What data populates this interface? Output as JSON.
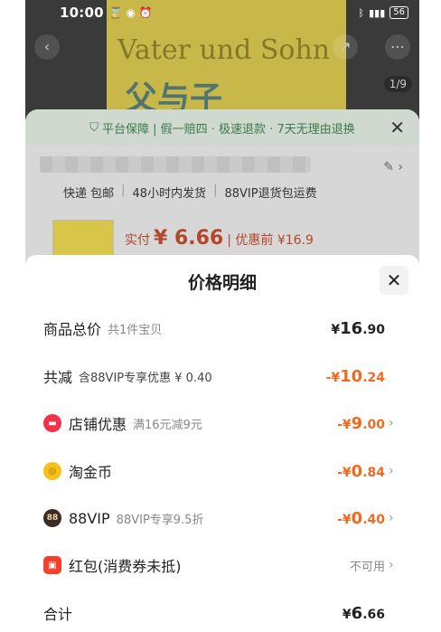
{
  "status": {
    "time": "10:00",
    "battery": "56"
  },
  "background": {
    "book_title": "Vater und Sohn",
    "book_cn": "父与子",
    "image_counter": "1/9",
    "guarantee": "平台保障 | 假一赔四 · 极速退款 · 7天无理由退换",
    "shipping": [
      "快递 包邮",
      "48小时内发货",
      "88VIP退货包运费"
    ],
    "actual_label": "实付",
    "actual_price": "¥ 6.66",
    "before_label": "| 优惠前 ¥16.9"
  },
  "sheet": {
    "title": "价格明细",
    "rows": [
      {
        "label": "商品总价",
        "sub": "共1件宝贝",
        "val_yen": "¥",
        "val_int": "16",
        "val_dec": ".90"
      },
      {
        "label": "共减",
        "sub": "含88VIP专享优惠 ¥ 0.40",
        "val_yen": "-¥",
        "val_int": "10",
        "val_dec": ".24"
      },
      {
        "label": "店铺优惠",
        "sub": "满16元减9元",
        "val_yen": "-¥",
        "val_int": "9",
        "val_dec": ".00"
      },
      {
        "label": "淘金币",
        "sub": "",
        "val_yen": "-¥",
        "val_int": "0",
        "val_dec": ".84"
      },
      {
        "label": "88VIP",
        "sub": "88VIP专享9.5折",
        "val_yen": "-¥",
        "val_int": "0",
        "val_dec": ".40"
      },
      {
        "label": "红包(消费券未抵)",
        "sub": "",
        "value_text": "不可用"
      },
      {
        "label": "合计",
        "sub": "",
        "val_yen": "¥",
        "val_int": "6",
        "val_dec": ".66"
      }
    ]
  },
  "colors": {
    "accent_orange": "#f06a1f",
    "shop_red": "#f0334a",
    "coin_yellow": "#f6c21a"
  },
  "icons": [
    "shop-icon",
    "coin-icon",
    "vip-icon",
    "red-packet-icon",
    "close-icon",
    "chevron-right-icon"
  ]
}
